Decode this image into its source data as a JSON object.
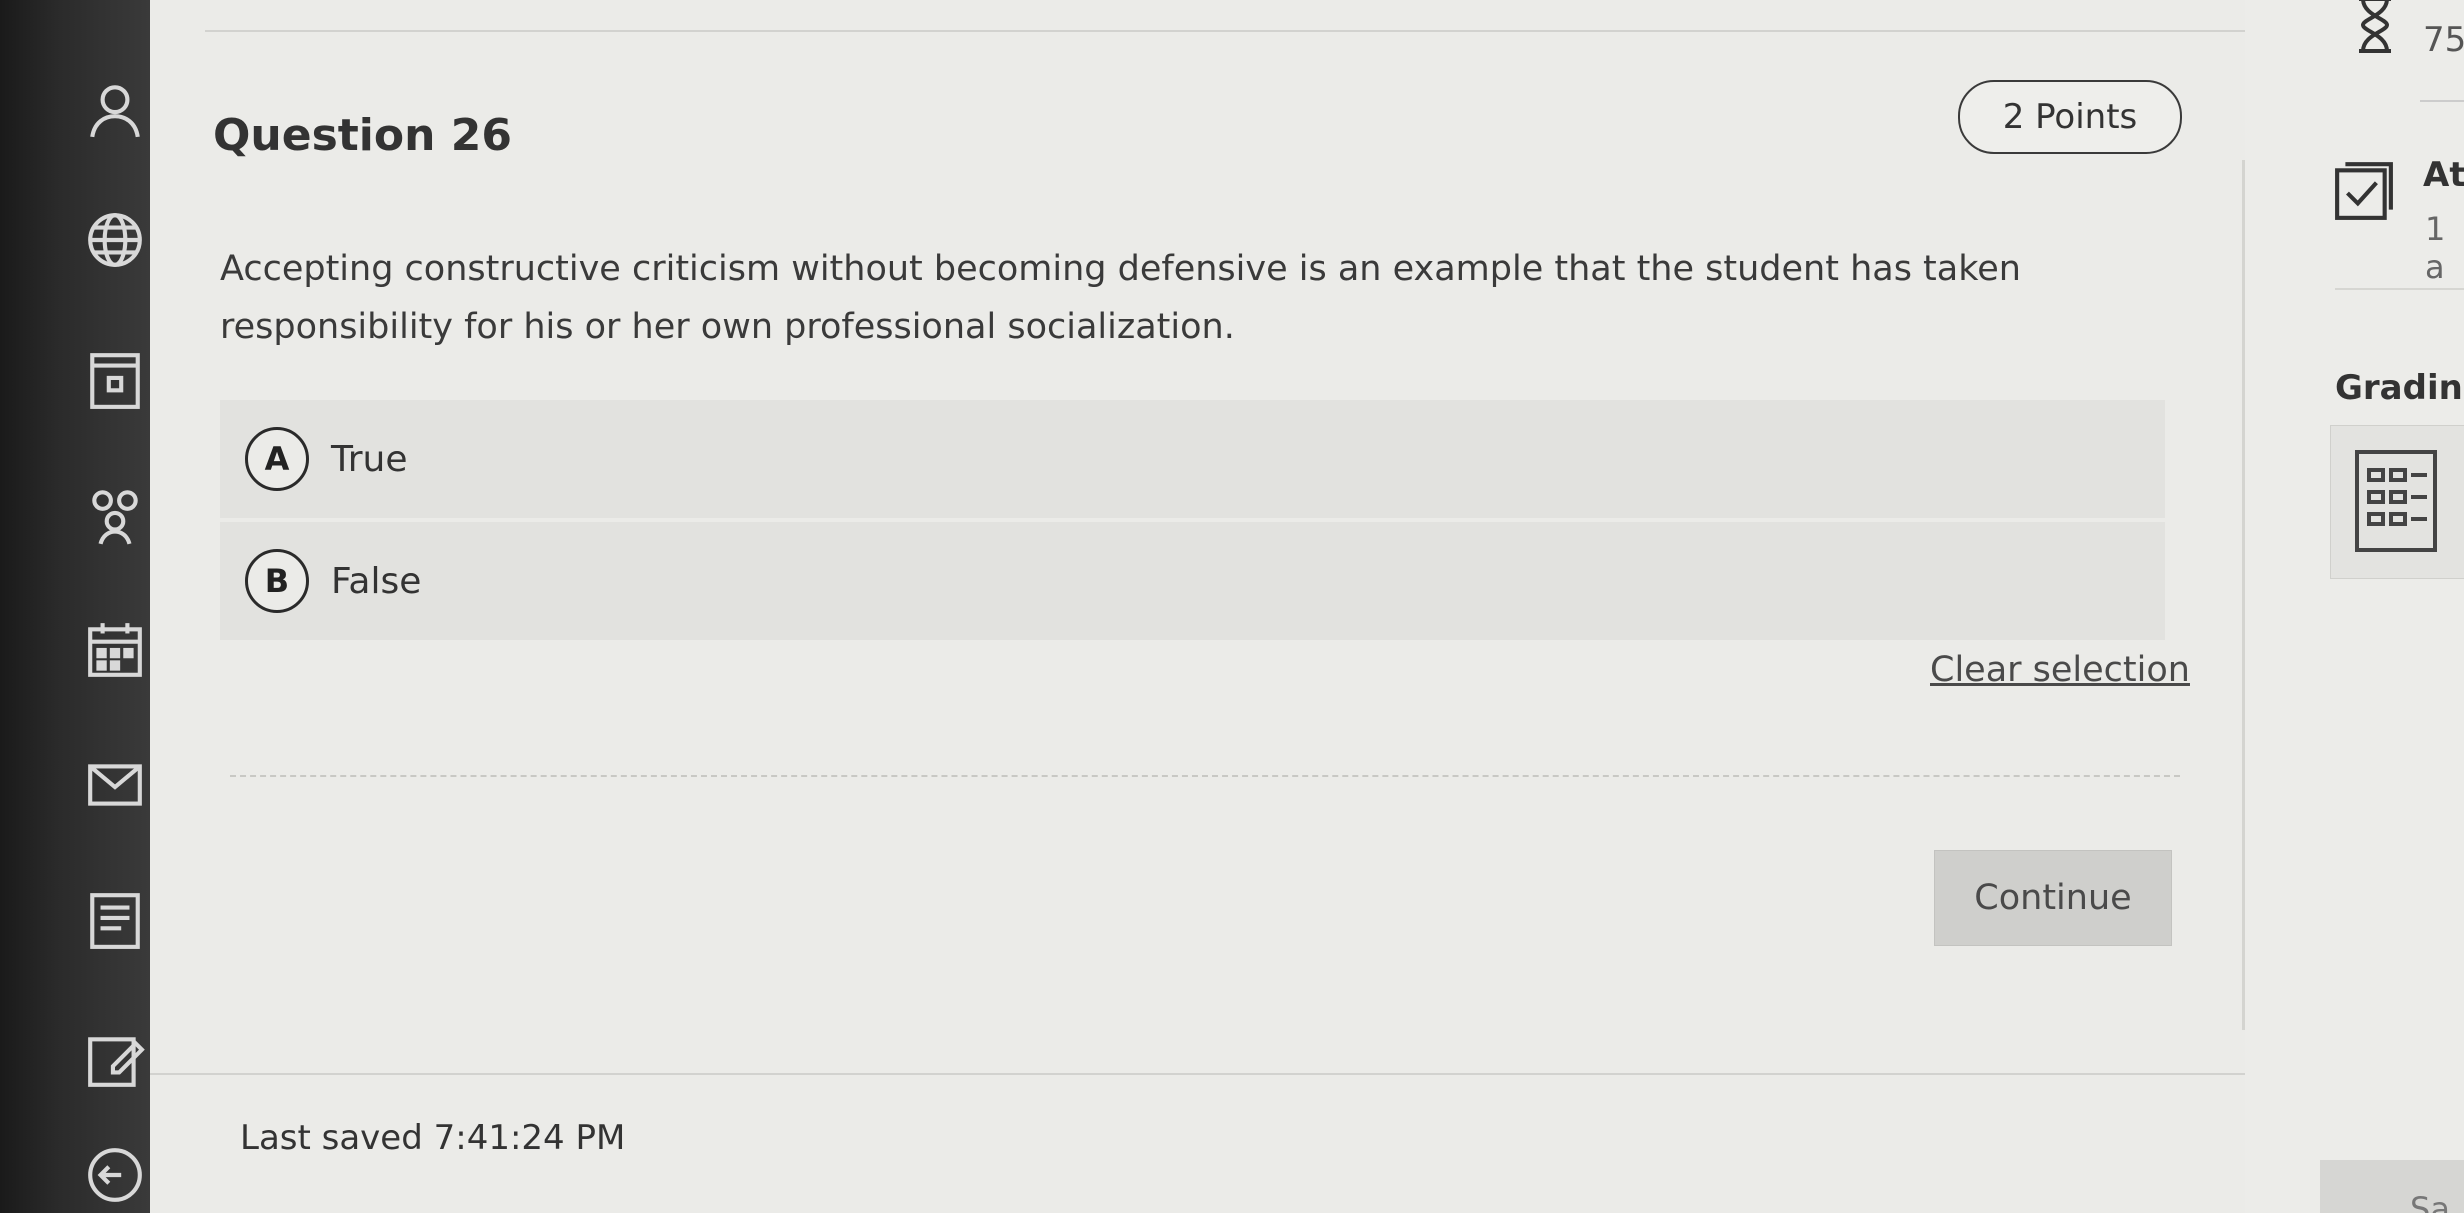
{
  "question": {
    "title": "Question 26",
    "points": "2 Points",
    "text": "Accepting constructive criticism without becoming defensive is an example that the student has taken responsibility for his or her own professional socialization.",
    "options": [
      {
        "letter": "A",
        "label": "True"
      },
      {
        "letter": "B",
        "label": "False"
      }
    ],
    "clear_label": "Clear selection",
    "continue_label": "Continue"
  },
  "footer": {
    "last_saved": "Last saved 7:41:24 PM"
  },
  "side_panel": {
    "timer_text": "75",
    "attempt_title": "At",
    "attempt_sub": "1 a",
    "grading_label": "Grading",
    "save_label": "Sa"
  },
  "nav_icons": [
    "profile-icon",
    "globe-icon",
    "institution-icon",
    "groups-icon",
    "calendar-icon",
    "messages-icon",
    "grades-icon",
    "edit-icon",
    "signout-icon"
  ],
  "colors": {
    "background": "#e9e9e6",
    "nav": "#2b2b2b",
    "button": "#cfcfcc"
  }
}
